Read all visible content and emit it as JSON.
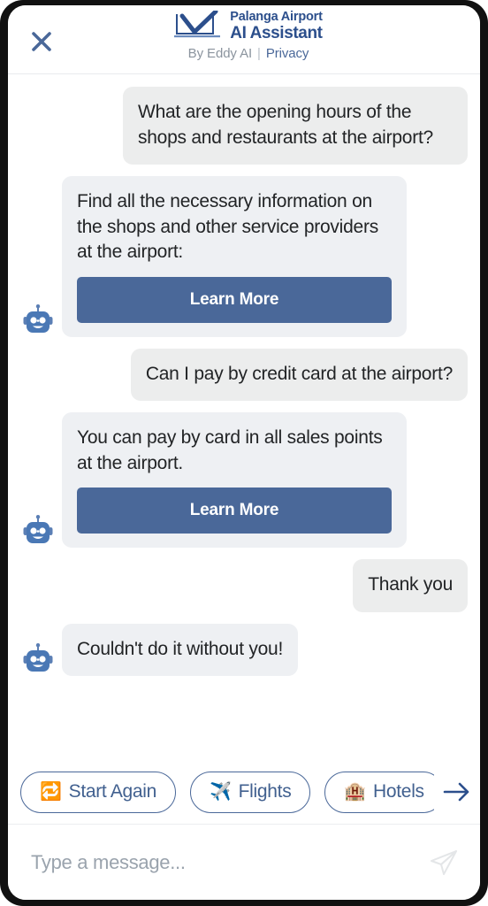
{
  "header": {
    "close_icon": "close-icon",
    "logo_icon": "palanga-airport-logo",
    "brand_line1": "Palanga Airport",
    "brand_line2": "AI Assistant",
    "by_label": "By Eddy AI",
    "separator": "|",
    "privacy_label": "Privacy",
    "brand_color": "#2c4f8c",
    "link_color": "#4a6899"
  },
  "chat": {
    "messages": [
      {
        "sender": "user",
        "text": "What are the opening hours of the shops and restaurants at the airport?"
      },
      {
        "sender": "bot",
        "avatar_icon": "robot-avatar-icon",
        "text": "Find all the necessary information on the shops and other service providers at the airport:",
        "cta_label": "Learn More"
      },
      {
        "sender": "user",
        "text": "Can I pay by credit card at the airport?"
      },
      {
        "sender": "bot",
        "avatar_icon": "robot-avatar-icon",
        "text": "You can pay by card in all sales points at the airport.",
        "cta_label": "Learn More"
      },
      {
        "sender": "user",
        "text": "Thank you"
      },
      {
        "sender": "bot",
        "avatar_icon": "robot-avatar-icon",
        "text": "Couldn't do it without you!"
      }
    ],
    "bot_bubble_color": "#eef0f3",
    "user_bubble_color": "#eceded",
    "cta_color": "#4a6899"
  },
  "quick_replies": {
    "chips": [
      {
        "emoji": "🔁",
        "label": "Start Again",
        "icon_name": "repeat-icon"
      },
      {
        "emoji": "✈️",
        "label": "Flights",
        "icon_name": "airplane-icon"
      },
      {
        "emoji": "🏨",
        "label": "Hotels",
        "icon_name": "hotel-icon"
      }
    ],
    "next_icon": "arrow-right-icon",
    "border_color": "#4a6899"
  },
  "input": {
    "value": "",
    "placeholder": "Type a message...",
    "send_icon": "send-paper-plane-icon"
  }
}
